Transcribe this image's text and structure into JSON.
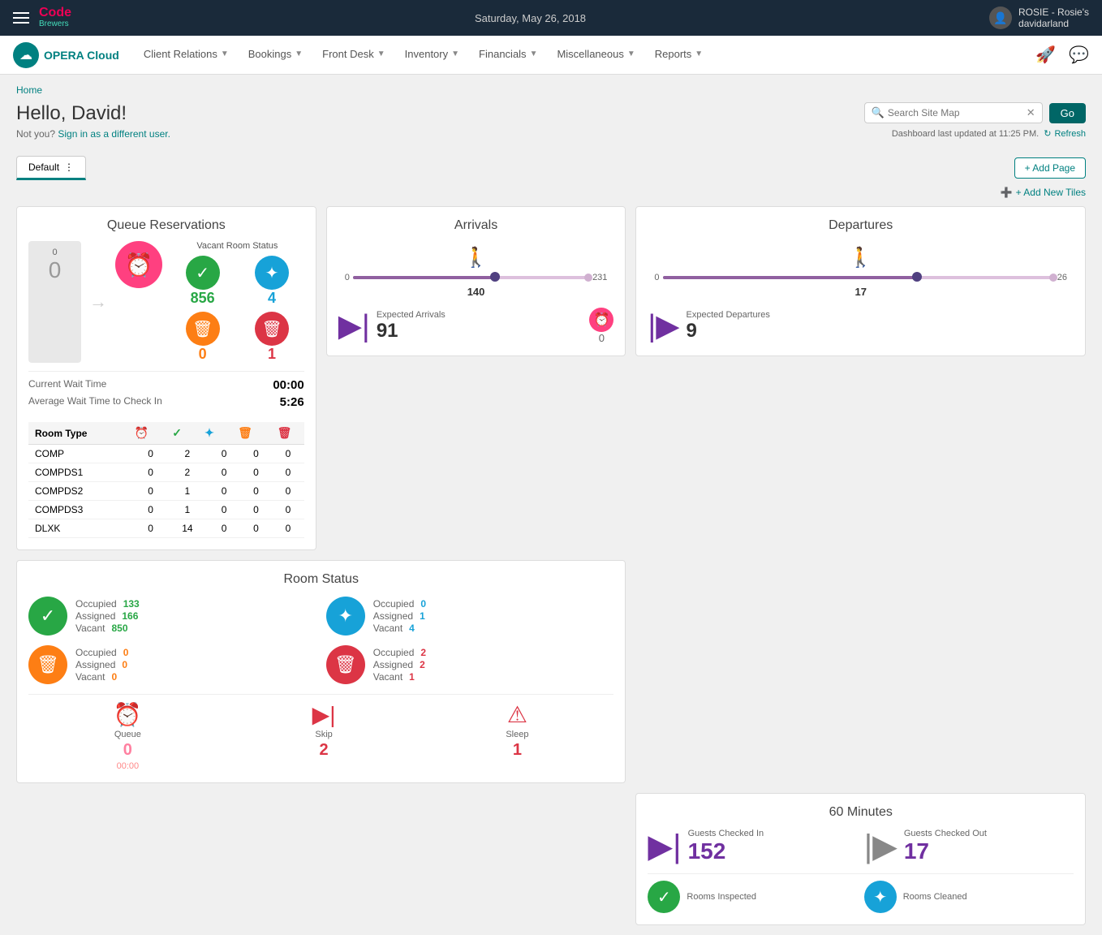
{
  "topbar": {
    "date": "Saturday, May 26, 2018",
    "user": "ROSIE - Rosie's",
    "sub": "davidarland"
  },
  "navbar": {
    "logo_text": "OPERA Cloud",
    "items": [
      {
        "label": "Client Relations",
        "id": "client-relations"
      },
      {
        "label": "Bookings",
        "id": "bookings"
      },
      {
        "label": "Front Desk",
        "id": "front-desk"
      },
      {
        "label": "Inventory",
        "id": "inventory"
      },
      {
        "label": "Financials",
        "id": "financials"
      },
      {
        "label": "Miscellaneous",
        "id": "miscellaneous"
      },
      {
        "label": "Reports",
        "id": "reports"
      }
    ]
  },
  "breadcrumb": "Home",
  "greeting": "Hello, David!",
  "sign_in_text": "Not you?",
  "sign_in_link": "Sign in as a different user.",
  "search": {
    "placeholder": "Search Site Map"
  },
  "go_button": "Go",
  "dashboard_updated": "Dashboard last updated at 11:25 PM.",
  "refresh_label": "Refresh",
  "tab_default": "Default",
  "add_page": "+ Add Page",
  "add_tiles": "+ Add New Tiles",
  "arrivals": {
    "title": "Arrivals",
    "min": "0",
    "max": "231",
    "current": "140",
    "expected_label": "Expected Arrivals",
    "expected_val": "91",
    "clock_val": "0",
    "fill_pct": "60"
  },
  "departures": {
    "title": "Departures",
    "min": "0",
    "max": "26",
    "current": "17",
    "expected_label": "Expected Departures",
    "expected_val": "9",
    "fill_pct": "65"
  },
  "queue_reservations": {
    "title": "Queue Reservations",
    "queue_val": "0",
    "vacant_title": "Vacant Room Status",
    "icons": [
      {
        "color": "green",
        "val": "856"
      },
      {
        "color": "blue",
        "val": "4"
      },
      {
        "color": "orange",
        "val": "0"
      },
      {
        "color": "red",
        "val": "1"
      }
    ],
    "current_wait_label": "Current Wait Time",
    "current_wait_val": "00:00",
    "avg_wait_label": "Average Wait Time to Check In",
    "avg_wait_val": "5:26",
    "table_headers": [
      "Room Type",
      "",
      "",
      "",
      "",
      ""
    ],
    "table_rows": [
      {
        "type": "COMP",
        "c1": "0",
        "c2": "2",
        "c3": "0",
        "c4": "0",
        "c5": "0"
      },
      {
        "type": "COMPDS1",
        "c1": "0",
        "c2": "2",
        "c3": "0",
        "c4": "0",
        "c5": "0"
      },
      {
        "type": "COMPDS2",
        "c1": "0",
        "c2": "1",
        "c3": "0",
        "c4": "0",
        "c5": "0"
      },
      {
        "type": "COMPDS3",
        "c1": "0",
        "c2": "1",
        "c3": "0",
        "c4": "0",
        "c5": "0"
      },
      {
        "type": "DLXK",
        "c1": "0",
        "c2": "14",
        "c3": "0",
        "c4": "0",
        "c5": "0"
      }
    ]
  },
  "room_status": {
    "title": "Room Status",
    "items": [
      {
        "color": "green",
        "occupied": "133",
        "assigned": "166",
        "vacant": "850"
      },
      {
        "color": "blue",
        "occupied": "0",
        "assigned": "1",
        "vacant": "4"
      },
      {
        "color": "orange",
        "occupied": "0",
        "assigned": "0",
        "vacant": "0"
      },
      {
        "color": "red",
        "occupied": "2",
        "assigned": "2",
        "vacant": "1"
      }
    ],
    "queue_label": "Queue",
    "queue_val": "0",
    "queue_wait": "00:00",
    "skip_label": "Skip",
    "skip_val": "2",
    "sleep_label": "Sleep",
    "sleep_val": "1"
  },
  "sixty_min": {
    "title": "60 Minutes",
    "checked_in_label": "Guests Checked In",
    "checked_in_val": "152",
    "checked_out_label": "Guests Checked Out",
    "checked_out_val": "17",
    "inspected_label": "Rooms Inspected",
    "cleaned_label": "Rooms Cleaned"
  }
}
